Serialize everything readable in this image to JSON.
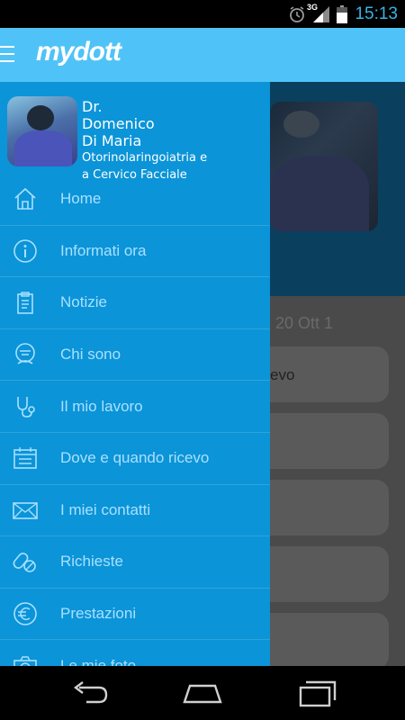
{
  "status_bar": {
    "time": "15:13",
    "network": "3G",
    "icons": [
      "alarm-icon",
      "signal-icon",
      "battery-icon"
    ],
    "time_color": "#33b5e5"
  },
  "app_bar": {
    "logo": "mydott",
    "menu_icon": "hamburger-icon",
    "color": "#4fc3f7"
  },
  "drawer": {
    "color": "#0b94d8",
    "profile": {
      "title": "Dr.",
      "first_name": "Domenico",
      "last_name": "Di Maria",
      "specialty": "Otorinolaringoiatria e\na Cervico Facciale"
    },
    "items": [
      {
        "label": "Home",
        "icon": "home-icon"
      },
      {
        "label": "Informati ora",
        "icon": "info-icon"
      },
      {
        "label": "Notizie",
        "icon": "clipboard-icon"
      },
      {
        "label": "Chi sono",
        "icon": "doctor-icon"
      },
      {
        "label": "Il mio lavoro",
        "icon": "stethoscope-icon"
      },
      {
        "label": "Dove e quando ricevo",
        "icon": "calendar-icon"
      },
      {
        "label": "I miei contatti",
        "icon": "envelope-icon"
      },
      {
        "label": "Richieste",
        "icon": "pills-icon"
      },
      {
        "label": "Prestazioni",
        "icon": "euro-icon"
      },
      {
        "label": "Le mie foto",
        "icon": "camera-icon"
      }
    ]
  },
  "background": {
    "date_fragment": "20 Ott 1",
    "card_text_fragment": "evo"
  },
  "nav_bar": {
    "buttons": [
      "back-icon",
      "home-nav-icon",
      "recents-icon"
    ]
  }
}
